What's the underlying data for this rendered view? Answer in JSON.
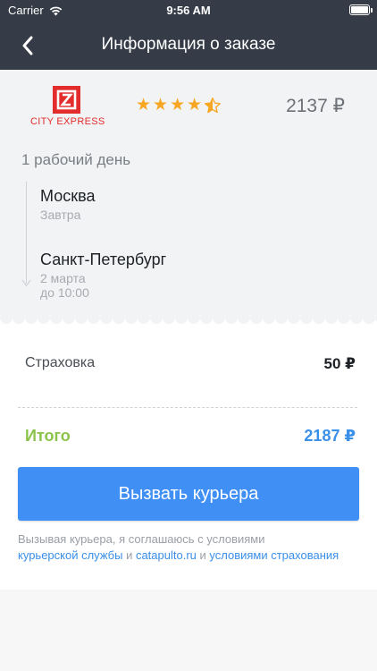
{
  "status_bar": {
    "carrier": "Carrier",
    "time": "9:56 AM",
    "battery_level": 1.0
  },
  "header": {
    "title": "Информация о заказе",
    "back_icon": "chevron-left-icon"
  },
  "courier": {
    "name": "CITY EXPRESS",
    "brand_color": "#e32c2c",
    "rating": 4.5,
    "rating_max": 5,
    "price": "2137 ₽"
  },
  "delivery": {
    "days": "1 рабочий день",
    "from": {
      "city": "Москва",
      "when": "Завтра"
    },
    "to": {
      "city": "Санкт-Петербург",
      "date": "2 марта",
      "time": "до 10:00"
    }
  },
  "summary": {
    "insurance_label": "Страховка",
    "insurance_value": "50 ₽",
    "total_label": "Итого",
    "total_value": "2187 ₽",
    "total_color": "#8bc34a",
    "total_value_color": "#3a8fe8"
  },
  "cta": {
    "label": "Вызвать курьера",
    "color": "#3f8ff5"
  },
  "terms": {
    "prefix": "Вызывая курьера, я соглашаюсь с условиями",
    "link1": "курьерской службы",
    "sep1": " и ",
    "link2": "catapulto.ru",
    "sep2": " и ",
    "link3": "условиями страхования"
  }
}
